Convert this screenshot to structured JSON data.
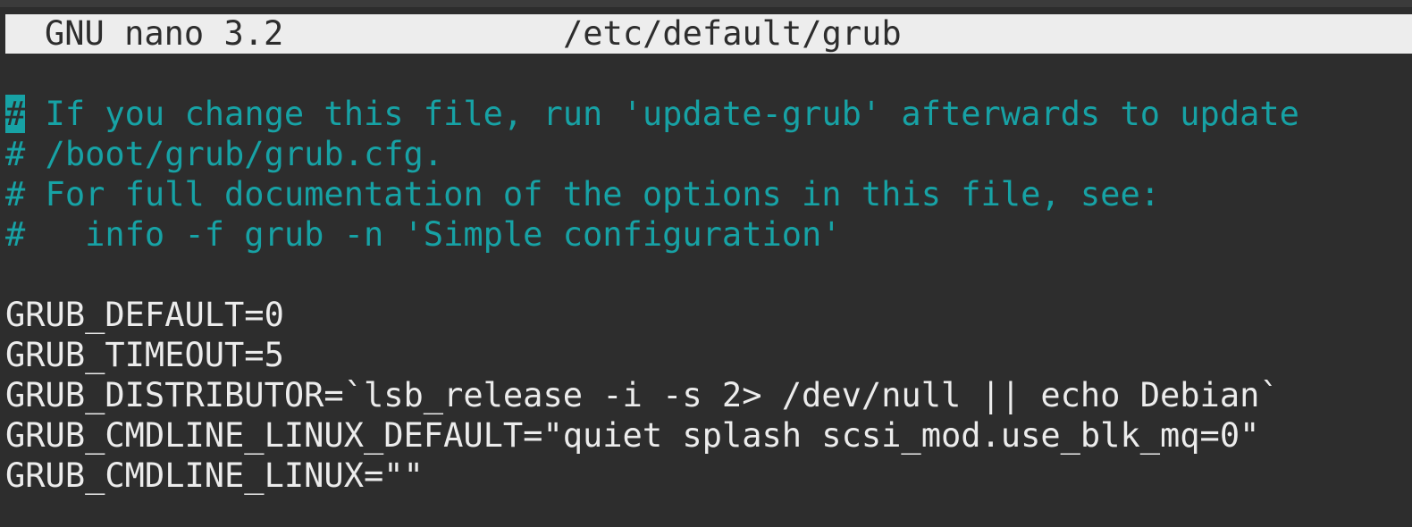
{
  "window": {
    "app_version": "GNU nano 3.2",
    "file_path": "/etc/default/grub"
  },
  "editor": {
    "cursor_char": "#",
    "lines": {
      "0": " If you change this file, run 'update-grub' afterwards to update",
      "1": "# /boot/grub/grub.cfg.",
      "2": "# For full documentation of the options in this file, see:",
      "3": "#   info -f grub -n 'Simple configuration'",
      "4": "",
      "5": "GRUB_DEFAULT=0",
      "6": "GRUB_TIMEOUT=5",
      "7": "GRUB_DISTRIBUTOR=`lsb_release -i -s 2> /dev/null || echo Debian`",
      "8": "GRUB_CMDLINE_LINUX_DEFAULT=\"quiet splash scsi_mod.use_blk_mq=0\"",
      "9": "GRUB_CMDLINE_LINUX=\"\""
    }
  },
  "colors": {
    "background": "#2d2d2d",
    "title_bar": "#ededed",
    "comment": "#17a2a5",
    "text": "#ececec"
  }
}
